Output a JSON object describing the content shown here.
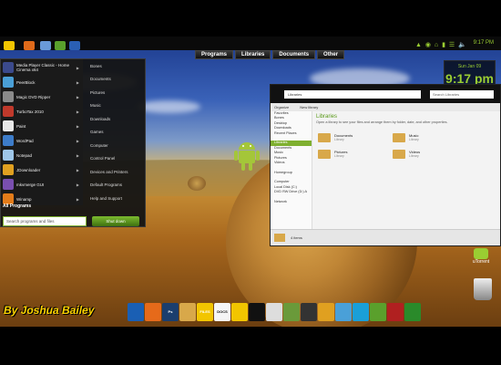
{
  "topbar": {
    "clock": "9:17 PM",
    "menus": [
      "Programs",
      "Libraries",
      "Documents",
      "Other"
    ]
  },
  "clock_widget": {
    "date": "Sun Jan 09",
    "time": "9:17 pm"
  },
  "start_menu": {
    "programs": [
      {
        "label": "Media Player Classic - Home Cinema x64",
        "icon": "media-player-icon",
        "color": "#3b4a8c"
      },
      {
        "label": "PeerBlock",
        "icon": "peerblock-icon",
        "color": "#4a9fd6"
      },
      {
        "label": "Magic DVD Ripper",
        "icon": "dvd-ripper-icon",
        "color": "#8a8a8a"
      },
      {
        "label": "TurboTax 2010",
        "icon": "turbotax-icon",
        "color": "#c0392b"
      },
      {
        "label": "Paint",
        "icon": "paint-icon",
        "color": "#e8e8e8"
      },
      {
        "label": "WordPad",
        "icon": "wordpad-icon",
        "color": "#3d7cc9"
      },
      {
        "label": "Notepad",
        "icon": "notepad-icon",
        "color": "#9ec6e8"
      },
      {
        "label": "JDownloader",
        "icon": "jdownloader-icon",
        "color": "#e0a020"
      },
      {
        "label": "mkvmerge GUI",
        "icon": "mkvmerge-icon",
        "color": "#7a4fb0"
      },
      {
        "label": "Winamp",
        "icon": "winamp-icon",
        "color": "#e37c1a"
      }
    ],
    "places": [
      "Bones",
      "Documents",
      "Pictures",
      "Music",
      "Downloads",
      "Games",
      "Computer",
      "Control Panel",
      "Devices and Printers",
      "Default Programs",
      "Help and Support"
    ],
    "all_programs": "All Programs",
    "search_placeholder": "Search programs and files",
    "shutdown": "Shut down"
  },
  "explorer": {
    "address": "Libraries",
    "search_placeholder": "Search Libraries",
    "toolbar": [
      "Organize",
      "New library"
    ],
    "nav": [
      "Favorites",
      "Bones",
      "Desktop",
      "Downloads",
      "Recent Places",
      "",
      "Libraries",
      "Documents",
      "Music",
      "Pictures",
      "Videos",
      "",
      "Homegroup",
      "",
      "Computer",
      "Local Disk (C:)",
      "DVD RW Drive (D:) A",
      "",
      "Network"
    ],
    "heading": "Libraries",
    "subheading": "Open a library to see your files and arrange them by folder, date, and other properties.",
    "libraries": [
      {
        "name": "Documents",
        "type": "Library"
      },
      {
        "name": "Music",
        "type": "Library"
      },
      {
        "name": "Pictures",
        "type": "Library"
      },
      {
        "name": "Videos",
        "type": "Library"
      }
    ],
    "status": "4 items"
  },
  "desktop": {
    "utorrent_label": "uTorrent"
  },
  "signature": "By Joshua Bailey",
  "dock": [
    {
      "icon": "windows-icon",
      "color": "#1a5fb4",
      "text": ""
    },
    {
      "icon": "firefox-icon",
      "color": "#e66a1a",
      "text": ""
    },
    {
      "icon": "photoshop-icon",
      "color": "#1b3e6e",
      "text": "Ps"
    },
    {
      "icon": "folder-icon",
      "color": "#d8a84a",
      "text": ""
    },
    {
      "icon": "files-icon",
      "color": "#f2c500",
      "text": "FILES"
    },
    {
      "icon": "docs-icon",
      "color": "#f5f5f5",
      "text": "DOCS"
    },
    {
      "icon": "arrow-icon",
      "color": "#f2c500",
      "text": ""
    },
    {
      "icon": "terminal-icon",
      "color": "#111",
      "text": ""
    },
    {
      "icon": "network-icon",
      "color": "#ddd",
      "text": ""
    },
    {
      "icon": "pictures-icon",
      "color": "#6a9a3a",
      "text": ""
    },
    {
      "icon": "media-icon",
      "color": "#333",
      "text": ""
    },
    {
      "icon": "player-icon",
      "color": "#e0a020",
      "text": ""
    },
    {
      "icon": "chat-icon",
      "color": "#4aa0d8",
      "text": ""
    },
    {
      "icon": "skype-icon",
      "color": "#1a9fd8",
      "text": ""
    },
    {
      "icon": "utorrent-dock-icon",
      "color": "#5aa02c",
      "text": ""
    },
    {
      "icon": "settings-icon",
      "color": "#b02020",
      "text": ""
    },
    {
      "icon": "recycle-icon",
      "color": "#2a8a2a",
      "text": ""
    }
  ]
}
